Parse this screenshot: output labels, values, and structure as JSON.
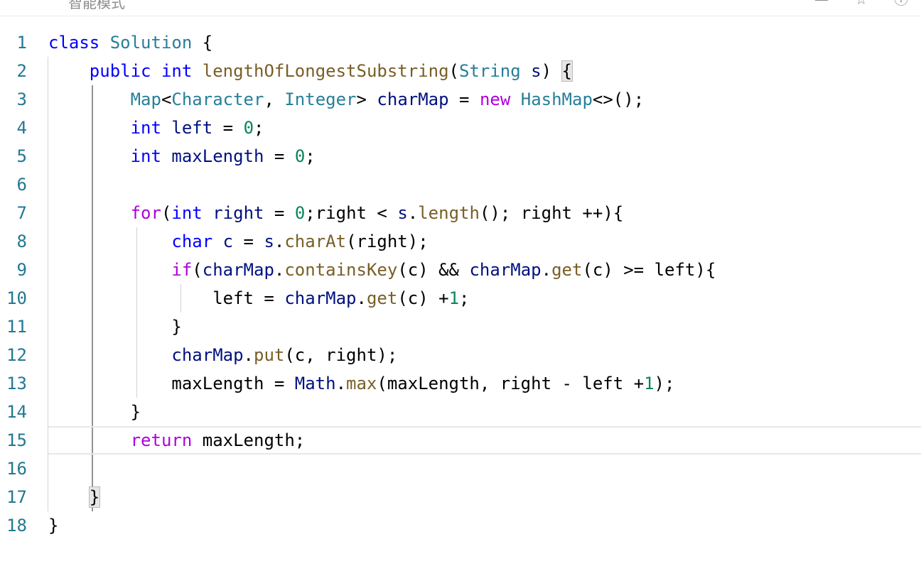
{
  "toolbar": {
    "mode_label": "智能模式",
    "icons": [
      "minimize-icon",
      "star-icon",
      "info-icon"
    ]
  },
  "editor": {
    "active_line": 15,
    "lines": [
      {
        "n": "1",
        "tokens": [
          [
            "kw",
            "class"
          ],
          [
            "txt",
            " "
          ],
          [
            "type",
            "Solution"
          ],
          [
            "txt",
            " {"
          ]
        ]
      },
      {
        "n": "2",
        "tokens": [
          [
            "txt",
            "    "
          ],
          [
            "kw",
            "public"
          ],
          [
            "txt",
            " "
          ],
          [
            "kw",
            "int"
          ],
          [
            "txt",
            " "
          ],
          [
            "fn",
            "lengthOfLongestSubstring"
          ],
          [
            "txt",
            "("
          ],
          [
            "type",
            "String"
          ],
          [
            "txt",
            " "
          ],
          [
            "var",
            "s"
          ],
          [
            "txt",
            ") "
          ],
          [
            "match",
            "{"
          ]
        ]
      },
      {
        "n": "3",
        "tokens": [
          [
            "txt",
            "        "
          ],
          [
            "type",
            "Map"
          ],
          [
            "txt",
            "<"
          ],
          [
            "type",
            "Character"
          ],
          [
            "txt",
            ", "
          ],
          [
            "type",
            "Integer"
          ],
          [
            "txt",
            "> "
          ],
          [
            "var",
            "charMap"
          ],
          [
            "txt",
            " = "
          ],
          [
            "ctrl",
            "new"
          ],
          [
            "txt",
            " "
          ],
          [
            "type",
            "HashMap"
          ],
          [
            "txt",
            "<>();"
          ]
        ]
      },
      {
        "n": "4",
        "tokens": [
          [
            "txt",
            "        "
          ],
          [
            "kw",
            "int"
          ],
          [
            "txt",
            " "
          ],
          [
            "var",
            "left"
          ],
          [
            "txt",
            " = "
          ],
          [
            "num",
            "0"
          ],
          [
            "txt",
            ";"
          ]
        ]
      },
      {
        "n": "5",
        "tokens": [
          [
            "txt",
            "        "
          ],
          [
            "kw",
            "int"
          ],
          [
            "txt",
            " "
          ],
          [
            "var",
            "maxLength"
          ],
          [
            "txt",
            " = "
          ],
          [
            "num",
            "0"
          ],
          [
            "txt",
            ";"
          ]
        ]
      },
      {
        "n": "6",
        "tokens": []
      },
      {
        "n": "7",
        "tokens": [
          [
            "txt",
            "        "
          ],
          [
            "ctrl",
            "for"
          ],
          [
            "txt",
            "("
          ],
          [
            "kw",
            "int"
          ],
          [
            "txt",
            " "
          ],
          [
            "var",
            "right"
          ],
          [
            "txt",
            " = "
          ],
          [
            "num",
            "0"
          ],
          [
            "txt",
            ";right < "
          ],
          [
            "var",
            "s"
          ],
          [
            "txt",
            "."
          ],
          [
            "fn",
            "length"
          ],
          [
            "txt",
            "(); right ++){"
          ]
        ]
      },
      {
        "n": "8",
        "tokens": [
          [
            "txt",
            "            "
          ],
          [
            "kw",
            "char"
          ],
          [
            "txt",
            " "
          ],
          [
            "var",
            "c"
          ],
          [
            "txt",
            " = "
          ],
          [
            "var",
            "s"
          ],
          [
            "txt",
            "."
          ],
          [
            "fn",
            "charAt"
          ],
          [
            "txt",
            "(right);"
          ]
        ]
      },
      {
        "n": "9",
        "tokens": [
          [
            "txt",
            "            "
          ],
          [
            "ctrl",
            "if"
          ],
          [
            "txt",
            "("
          ],
          [
            "var",
            "charMap"
          ],
          [
            "txt",
            "."
          ],
          [
            "fn",
            "containsKey"
          ],
          [
            "txt",
            "(c) && "
          ],
          [
            "var",
            "charMap"
          ],
          [
            "txt",
            "."
          ],
          [
            "fn",
            "get"
          ],
          [
            "txt",
            "(c) >= left){"
          ]
        ]
      },
      {
        "n": "10",
        "tokens": [
          [
            "txt",
            "                left = "
          ],
          [
            "var",
            "charMap"
          ],
          [
            "txt",
            "."
          ],
          [
            "fn",
            "get"
          ],
          [
            "txt",
            "(c) +"
          ],
          [
            "num",
            "1"
          ],
          [
            "txt",
            ";"
          ]
        ]
      },
      {
        "n": "11",
        "tokens": [
          [
            "txt",
            "            }"
          ]
        ]
      },
      {
        "n": "12",
        "tokens": [
          [
            "txt",
            "            "
          ],
          [
            "var",
            "charMap"
          ],
          [
            "txt",
            "."
          ],
          [
            "fn",
            "put"
          ],
          [
            "txt",
            "(c, right);"
          ]
        ]
      },
      {
        "n": "13",
        "tokens": [
          [
            "txt",
            "            maxLength = "
          ],
          [
            "var",
            "Math"
          ],
          [
            "txt",
            "."
          ],
          [
            "fn",
            "max"
          ],
          [
            "txt",
            "(maxLength, right - left +"
          ],
          [
            "num",
            "1"
          ],
          [
            "txt",
            ");"
          ]
        ]
      },
      {
        "n": "14",
        "tokens": [
          [
            "txt",
            "        }"
          ]
        ]
      },
      {
        "n": "15",
        "tokens": [
          [
            "txt",
            "        "
          ],
          [
            "ctrl",
            "return"
          ],
          [
            "txt",
            " maxLength;"
          ]
        ]
      },
      {
        "n": "16",
        "tokens": []
      },
      {
        "n": "17",
        "tokens": [
          [
            "txt",
            "    "
          ],
          [
            "match",
            "}"
          ]
        ]
      },
      {
        "n": "18",
        "tokens": [
          [
            "txt",
            "}"
          ]
        ]
      }
    ]
  }
}
